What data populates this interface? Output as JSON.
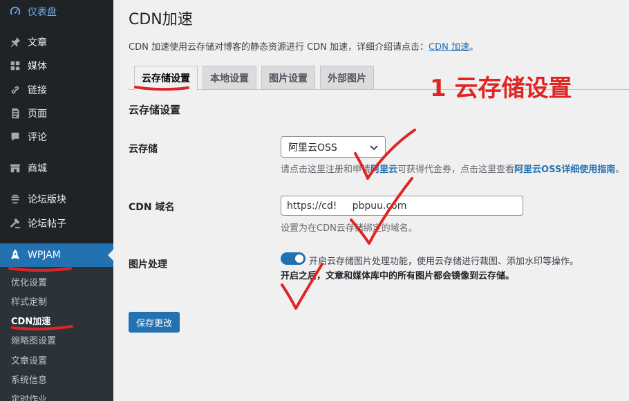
{
  "sidebar": {
    "items": [
      {
        "label": "仪表盘",
        "icon": "dashboard-icon"
      },
      {
        "label": "文章",
        "icon": "pin-icon"
      },
      {
        "label": "媒体",
        "icon": "media-icon"
      },
      {
        "label": "链接",
        "icon": "link-icon"
      },
      {
        "label": "页面",
        "icon": "page-icon"
      },
      {
        "label": "评论",
        "icon": "comment-icon"
      },
      {
        "label": "商城",
        "icon": "store-icon"
      },
      {
        "label": "论坛版块",
        "icon": "forum-icon"
      },
      {
        "label": "论坛帖子",
        "icon": "hammer-icon"
      },
      {
        "label": "WPJAM",
        "icon": "rocket-icon"
      }
    ],
    "submenu": [
      "优化设置",
      "样式定制",
      "CDN加速",
      "缩略图设置",
      "文章设置",
      "系统信息",
      "定时作业"
    ],
    "current_submenu": "CDN加速"
  },
  "page": {
    "title": "CDN加速",
    "description": "CDN 加速使用云存储对博客的静态资源进行 CDN 加速，详细介绍请点击：",
    "description_link": "CDN 加速",
    "description_end": "。"
  },
  "tabs": [
    "云存储设置",
    "本地设置",
    "图片设置",
    "外部图片"
  ],
  "active_tab": "云存储设置",
  "form": {
    "section_title": "云存储设置",
    "storage_label": "云存储",
    "storage_value": "阿里云OSS",
    "storage_hint_1": "请点击这里注册和申请",
    "storage_hint_link1": "阿里云",
    "storage_hint_2": "可获得代金券，点击这里查看",
    "storage_hint_link2": "阿里云OSS详细使用指南",
    "storage_hint_3": "。",
    "domain_label": "CDN 域名",
    "domain_value": "https://cd!     pbpuu.com",
    "domain_hint": "设置为在CDN云存储绑定的域名。",
    "image_label": "图片处理",
    "image_toggle_text": "开启云存储图片处理功能，使用云存储进行裁图、添加水印等操作。",
    "image_toggle_note": "开启之后，文章和媒体库中的所有图片都会镜像到云存储。",
    "image_toggle_on": true,
    "save_label": "保存更改"
  },
  "annotation": {
    "text": "1 云存储设置",
    "color": "#e02424"
  },
  "colors": {
    "sidebar_bg": "#1d2327",
    "accent": "#2271b1",
    "annotation": "#e02424"
  }
}
